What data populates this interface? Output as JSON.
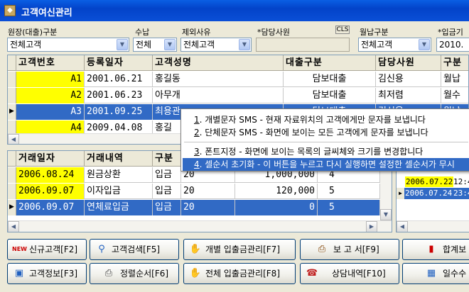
{
  "window": {
    "title": "고객여신관리"
  },
  "filters": {
    "branch_label": "원장(대출)구분",
    "branch_value": "전체고객",
    "repay_label": "수납",
    "repay_value": "전체",
    "exclude_label": "제외사유",
    "exclude_value": "전체고객",
    "staff_label": "*담당사원",
    "staff_value": "",
    "cls_label": "CLS",
    "repay_type_label": "월납구분",
    "repay_type_value": "전체고객",
    "start_label": "*입금기",
    "start_value": "2010."
  },
  "customer_grid": {
    "columns": [
      "고객번호",
      "등록일자",
      "고객성명",
      "대출구분",
      "담당사원",
      "구분"
    ],
    "rows": [
      {
        "id": "A1",
        "date": "2001.06.21",
        "name": "홍길동",
        "loan": "담보대출",
        "staff": "김신용",
        "type": "월납"
      },
      {
        "id": "A2",
        "date": "2001.06.23",
        "name": "아무개",
        "loan": "담보대출",
        "staff": "최저렴",
        "type": "월수"
      },
      {
        "id": "A3",
        "date": "2001.09.25",
        "name": "최용관",
        "loan": "담보대출",
        "staff": "김신용",
        "type": "월납"
      },
      {
        "id": "A4",
        "date": "2009.04.08",
        "name": "홍길",
        "loan": "",
        "staff": "",
        "type": ""
      }
    ]
  },
  "context_menu": {
    "items": [
      {
        "key": "1",
        "text": ". 개별문자 SMS - 현재 자료위치의 고객에게만 문자를 보냅니다"
      },
      {
        "key": "2",
        "text": ". 단체문자 SMS - 화면에 보이는 모든 고객에게 문자를 보냅니다"
      },
      {
        "key": "3",
        "text": ". 폰트지정 - 화면에 보이는  목록의 글씨체와 크기를 변경합니다"
      },
      {
        "key": "4",
        "text": ". 셀순서 초기화 - 이 버튼을 누르고 다시 실행하면 설정한 셀순서가 무시"
      }
    ]
  },
  "transaction_grid": {
    "columns": [
      "거래일자",
      "거래내역",
      "구분"
    ],
    "rows": [
      {
        "date": "2006.08.24",
        "desc": "원금상환",
        "type": "입금",
        "c4": "20",
        "amount": "1,000,000",
        "count": "4"
      },
      {
        "date": "2006.09.07",
        "desc": "이자입금",
        "type": "입금",
        "c4": "20",
        "amount": "120,000",
        "count": "5"
      },
      {
        "date": "2006.09.07",
        "desc": "연체료입금",
        "type": "입금",
        "c4": "20",
        "amount": "0",
        "count": "5"
      }
    ]
  },
  "side_grid": {
    "rows": [
      {
        "date": "2006.07.22",
        "time": "12:4"
      },
      {
        "date": "2006.07.24",
        "time": "23:4"
      }
    ]
  },
  "buttons": {
    "new_customer": "신규고객[F2]",
    "search_customer": "고객검색[F5]",
    "individual_payment": "개별 입출금관리[F7]",
    "report": "보 고 서[F9]",
    "summary": "합계보",
    "customer_info": "고객정보[F3]",
    "sort_order": "정렬순서[F6]",
    "all_payment": "전체 입출금관리[F8]",
    "consult": "상담내역[F10]",
    "daily": "일수수"
  },
  "colors": {
    "titlebar": "#0a4fd7",
    "selection": "#316ac5",
    "highlight": "#ffff00"
  }
}
